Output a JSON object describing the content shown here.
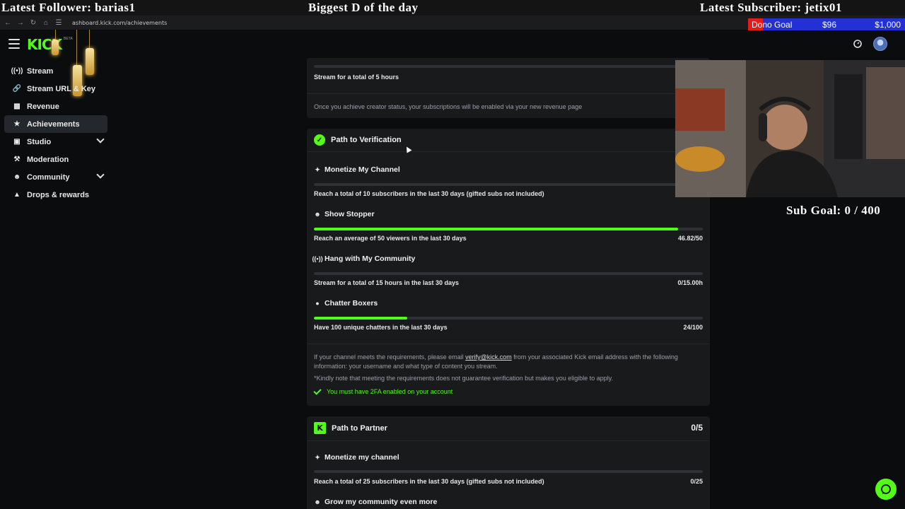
{
  "overlay": {
    "latest_follower": "Latest Follower: barias1",
    "center_title": "Biggest D of the day",
    "latest_subscriber": "Latest Subscriber: jetix01",
    "sub_goal": "Sub Goal: 0 / 400"
  },
  "dono_goal": {
    "label": "Dono Goal",
    "current": "$96",
    "target": "$1,000",
    "progress_fraction": 0.096
  },
  "browser": {
    "url": "ashboard.kick.com/achievements"
  },
  "header": {
    "logo_text": "KICK",
    "beta_label": "BETA"
  },
  "sidebar": {
    "items": [
      {
        "label": "Stream",
        "icon": "broadcast-icon"
      },
      {
        "label": "Stream URL & Key",
        "icon": "link-icon"
      },
      {
        "label": "Revenue",
        "icon": "chart-icon"
      },
      {
        "label": "Achievements",
        "icon": "trophy-icon"
      },
      {
        "label": "Studio",
        "icon": "studio-icon"
      },
      {
        "label": "Moderation",
        "icon": "wrench-icon"
      },
      {
        "label": "Community",
        "icon": "people-icon"
      },
      {
        "label": "Drops & rewards",
        "icon": "gift-icon"
      }
    ]
  },
  "creator_card": {
    "stream_hours_text": "Stream for a total of 5 hours",
    "note": "Once you achieve creator status, your subscriptions will be enabled via your new revenue page"
  },
  "verification": {
    "title": "Path to Verification",
    "requirements": [
      {
        "title": "Monetize My Channel",
        "icon": "sparkle-icon",
        "desc": "Reach a total of 10 subscribers in the last 30 days (gifted subs not included)",
        "value": "",
        "progress": 0
      },
      {
        "title": "Show Stopper",
        "icon": "people-icon",
        "desc": "Reach an average of 50 viewers in the last 30 days",
        "value": "46.82/50",
        "progress": 0.9364
      },
      {
        "title": "Hang with My Community",
        "icon": "broadcast-icon",
        "desc": "Stream for a total of 15 hours in the last 30 days",
        "value": "0/15.00h",
        "progress": 0
      },
      {
        "title": "Chatter Boxers",
        "icon": "chat-icon",
        "desc": "Have 100 unique chatters in the last 30 days",
        "value": "24/100",
        "progress": 0.24
      }
    ],
    "info_before_email": "If your channel meets the requirements, please email ",
    "email": "verify@kick.com",
    "info_after_email": " from your associated Kick email address with the following",
    "info_line2": "information: your username and what type of content you stream.",
    "disclaimer": "*Kindly note that meeting the requirements does not guarantee verification but makes you eligible to apply.",
    "twofa": "You must have 2FA enabled on your account"
  },
  "partner": {
    "title": "Path to Partner",
    "count": "0/5",
    "requirements": [
      {
        "title": "Monetize my channel",
        "icon": "sparkle-icon",
        "desc": "Reach a total of 25 subscribers in the last 30 days (gifted subs not included)",
        "value": "0/25",
        "progress": 0
      },
      {
        "title": "Grow my community even more",
        "icon": "people-icon"
      }
    ]
  }
}
